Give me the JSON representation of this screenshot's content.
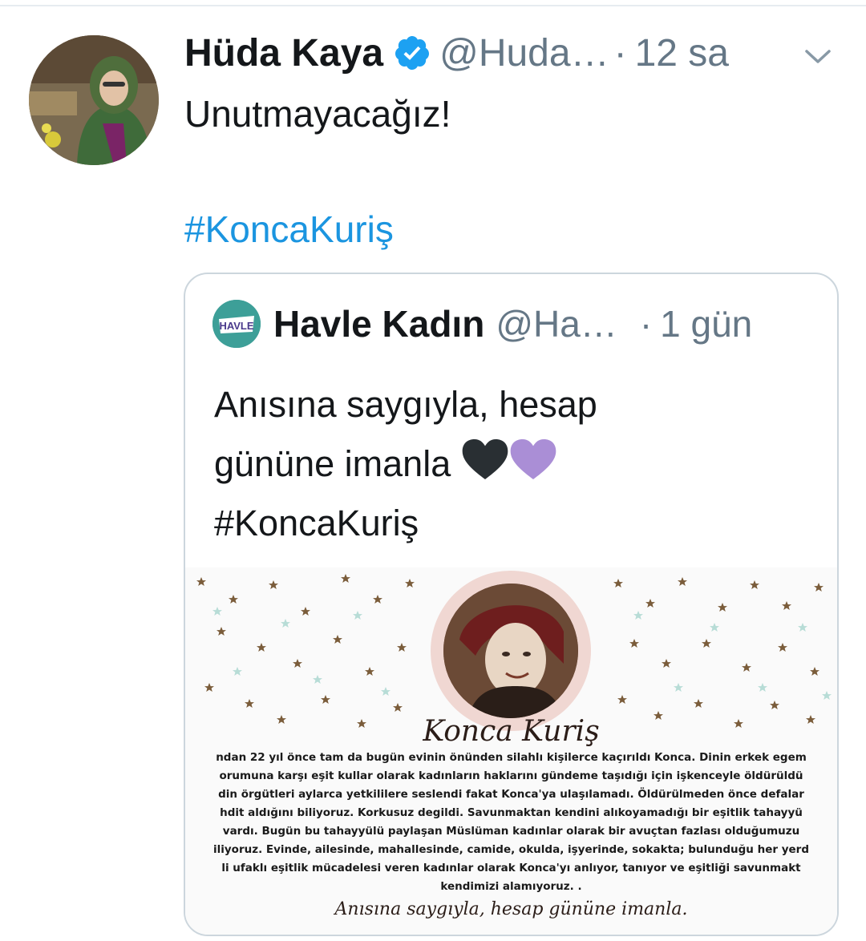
{
  "tweet": {
    "author_name": "Hüda Kaya",
    "handle": "@Huda…",
    "separator": "·",
    "time": "12 sa",
    "text": "Unutmayacağız!",
    "hashtag": "#KoncaKuriş"
  },
  "quoted_tweet": {
    "author_name": "Havle Kadın",
    "handle": "@Ha…",
    "separator": "·",
    "time": "1 gün",
    "text_line1": "Anısına saygıyla, hesap",
    "text_line2": "gününe imanla",
    "hashtag": "#KoncaKuriş",
    "avatar_text": "HAVLE",
    "image": {
      "title": "Konca Kuriş",
      "body_lines": [
        "ndan 22 yıl önce tam da bugün evinin önünden silahlı kişilerce kaçırıldı Konca. Dinin erkek egem",
        "orumuna karşı eşit kullar olarak kadınların haklarını gündeme taşıdığı için işkenceyle öldürüldü",
        "din örgütleri aylarca yetkililere seslendi fakat Konca'ya ulaşılamadı. Öldürülmeden önce defalar",
        "hdit aldığını biliyoruz. Korkusuz degildi. Savunmaktan kendini alıkoyamadığı bir eşitlik tahayyü",
        "vardı. Bugün bu tahayyülü paylaşan Müslüman kadınlar olarak bir avuçtan fazlası olduğumuzu",
        "iliyoruz. Evinde, ailesinde, mahallesinde, camide, okulda, işyerinde, sokakta; bulunduğu her yerd",
        "li ufaklı eşitlik mücadelesi veren kadınlar olarak Konca'yı anlıyor, tanıyor ve eşitliği savunmakt",
        "kendimizi alamıyoruz. ."
      ],
      "footer": "Anısına saygıyla, hesap gününe imanla."
    }
  },
  "colors": {
    "link": "#1b95e0",
    "secondary_text": "#657786",
    "verified": "#1da1f2",
    "border": "#ccd6dd",
    "heart_black": "#292f33",
    "heart_purple": "#aa8ed6"
  },
  "icons": {
    "verified": "verified-badge-icon",
    "chevron": "chevron-down-icon",
    "black_heart": "black-heart-emoji",
    "purple_heart": "purple-heart-emoji"
  }
}
